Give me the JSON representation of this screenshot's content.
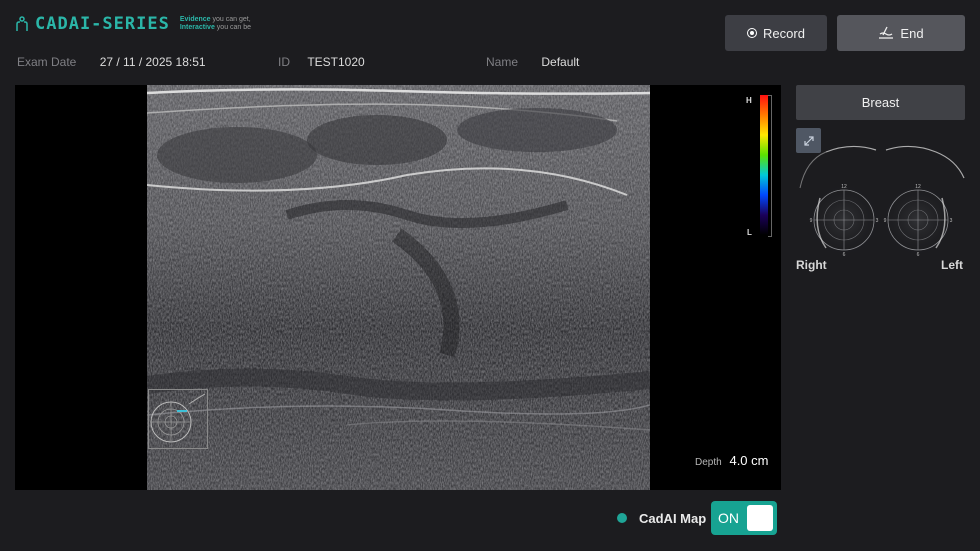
{
  "header": {
    "logo_text": "CADAI-SERIES",
    "tagline_line1_bold": "Evidence",
    "tagline_line1_rest": " you can get,",
    "tagline_line2_bold": "Interactive",
    "tagline_line2_rest": " you can be",
    "record_label": "Record",
    "end_label": "End"
  },
  "exam": {
    "date_label": "Exam Date",
    "date_value": "27 / 11 / 2025 18:51",
    "id_label": "ID",
    "id_value": "TEST1020",
    "name_label": "Name",
    "name_value": "Default"
  },
  "viewer": {
    "colorbar_high": "H",
    "colorbar_low": "L",
    "depth_label": "Depth",
    "depth_value": "4.0 cm"
  },
  "cadai_map": {
    "label": "CadAI Map",
    "state": "ON",
    "accent_color": "#17a392"
  },
  "right_panel": {
    "body_part": "Breast",
    "right_label": "Right",
    "left_label": "Left",
    "clock_labels": {
      "top": "12",
      "right": "3",
      "bottom": "6",
      "left": "9"
    }
  },
  "icons": [
    "cadai-logo-icon",
    "record-icon",
    "end-icon",
    "expand-icon"
  ],
  "colors": {
    "brand": "#2bb6a8",
    "background": "#1c1c1f",
    "button": "#3d3e44"
  }
}
